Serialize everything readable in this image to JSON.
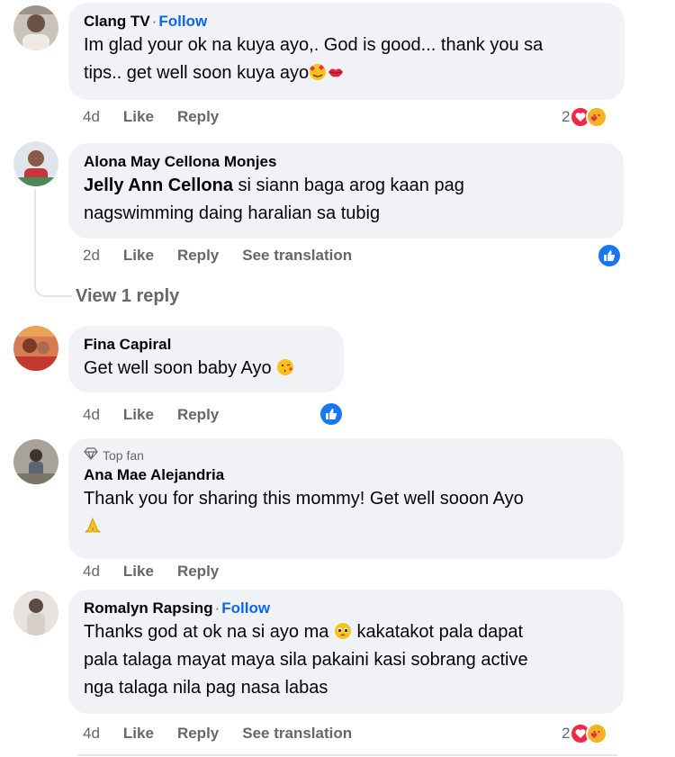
{
  "comments": [
    {
      "author": "Clang TV",
      "follow": "Follow",
      "text": "Im glad your ok na kuya ayo,. God is good... thank you sa tips.. get well soon kuya ayo",
      "line1": "Im glad your ok na kuya ayo,. God is good... thank you sa",
      "line2": "tips.. get well soon kuya ayo",
      "time": "4d",
      "like": "Like",
      "reply": "Reply",
      "reaction_count": "2",
      "reactions": [
        "love-icon",
        "care-icon"
      ]
    },
    {
      "author": "Alona May Cellona Monjes",
      "mention": "Jelly Ann Cellona",
      "line1_rest": " si siann baga arog kaan pag",
      "line2": "nagswimming daing haralian sa tubig",
      "time": "2d",
      "like": "Like",
      "reply": "Reply",
      "see_translation": "See translation",
      "reactions": [
        "like-icon"
      ]
    },
    {
      "view_replies": "View 1 reply"
    },
    {
      "author": "Fina Capiral",
      "line1": "Get well soon baby Ayo",
      "time": "4d",
      "like": "Like",
      "reply": "Reply",
      "reactions": [
        "like-icon"
      ]
    },
    {
      "badge": "Top fan",
      "author": "Ana Mae Alejandria",
      "line1": "Thank you for sharing this mommy! Get well sooon Ayo",
      "time": "4d",
      "like": "Like",
      "reply": "Reply"
    },
    {
      "author": "Romalyn Rapsing",
      "follow": "Follow",
      "line1a": "Thanks god at ok na si ayo ma",
      "line1b": "kakatakot pala dapat",
      "line2": "pala talaga mayat maya sila pakaini kasi sobrang active",
      "line3": "nga talaga nila pag nasa labas",
      "time": "4d",
      "like": "Like",
      "reply": "Reply",
      "see_translation": "See translation",
      "reaction_count": "2",
      "reactions": [
        "love-icon",
        "care-icon"
      ]
    }
  ],
  "colors": {
    "bubble": "#f0f2f5",
    "meta_text": "#65676b",
    "link_blue": "#0866ff",
    "love_red": "#f02849",
    "like_blue": "#1877f2"
  }
}
